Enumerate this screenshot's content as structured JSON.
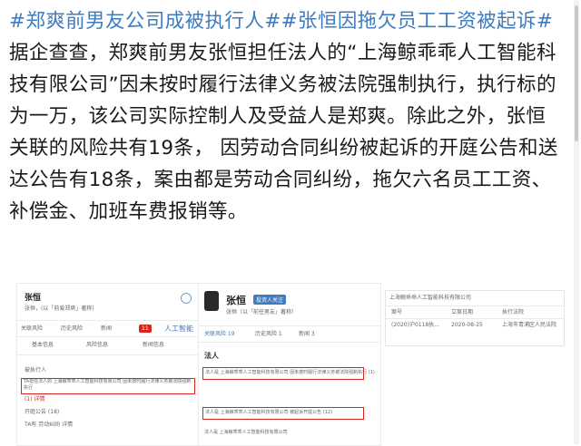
{
  "post": {
    "tag1": "#郑爽前男友公司成被执行人#",
    "tag2": "#张恒因拖欠员工工资被起诉#",
    "body": " 据企查查，郑爽前男友张恒担任法人的“上海鲸乖乖人工智能科技有限公司”因未按时履行法律义务被法院强制执行，执行标的为一万，该公司实际控制人及受益人是郑爽。除此之外，张恒关联的风险共有19条， 因劳动合同纠纷被起诉的开庭公告和送达公告有18条，案由都是劳动合同纠纷，拖欠六名员工工资、补偿金、加班车费报销等。"
  },
  "shot1": {
    "name": "张恒",
    "line1": "张恒，(以「前爱郑爽」著称)",
    "tabs": [
      "关联风险",
      "历史风险",
      "新闻"
    ],
    "tab_count": "11",
    "badge": "人工智能",
    "sub_labels": [
      "基本信息",
      "风险信息",
      "新闻信息"
    ],
    "row_head": "被执行人",
    "highlight": "TA担任法人的 上海鲸乖乖人工智能科技有限公司 因未按时履行法律义务被法院强制执行",
    "row2": "(1) 详情",
    "row3": "开庭公告 (18)",
    "row4": "TA有 劳动纠纷 详情"
  },
  "shot2": {
    "name": "张恒",
    "badge": "投资人关注",
    "line1": "张恒（以「前任男友」著称）",
    "tabs": [
      "关联风险 19",
      "历史风险 1",
      "新闻 3"
    ],
    "label": "法人",
    "rows": [
      "法人是 上海鲸乖乖人工智能科技有限公司 因未按时履行法律义务被法院强制执行 (1)",
      "法人是 上海鲸乖乖人工智能科技有限公司 被起诉开庭公告 (12)",
      "法人是 上海鲸乖乖人工智能科技有限公司"
    ]
  },
  "shot3": {
    "title": "上海鲸乖乖人工智能科技有限公司",
    "headers": [
      "案号",
      "立案日期",
      "执行法院"
    ],
    "row": [
      "(2020)沪0118执...",
      "2020-08-25",
      "上海市青浦区人民法院"
    ]
  }
}
